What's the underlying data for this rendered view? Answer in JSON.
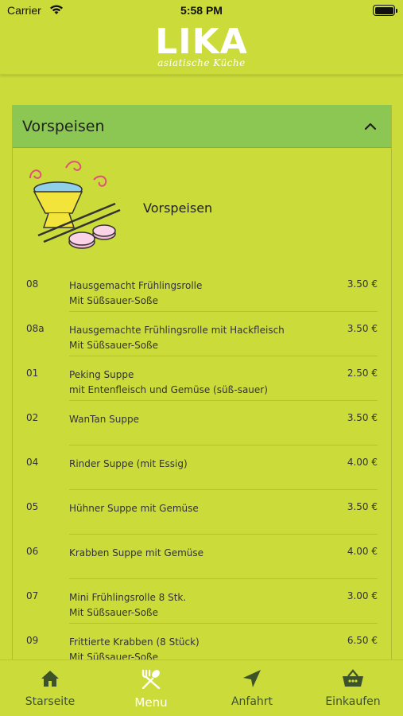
{
  "status": {
    "carrier": "Carrier",
    "time": "5:58 PM"
  },
  "header": {
    "logo": "LIKA",
    "tagline": "asiatische Küche"
  },
  "section": {
    "title": "Vorspeisen",
    "intro_title": "Vorspeisen"
  },
  "items": [
    {
      "num": "08",
      "line1": "Hausgemacht Frühlingsrolle",
      "line2": "Mit Süßsauer-Soße",
      "price": "3.50 €"
    },
    {
      "num": "08a",
      "line1": "Hausgemachte Frühlingsrolle mit Hackfleisch",
      "line2": "Mit Süßsauer-Soße",
      "price": "3.50 €"
    },
    {
      "num": "01",
      "line1": "Peking Suppe",
      "line2": "mit Entenfleisch und Gemüse (süß-sauer)",
      "price": "2.50 €"
    },
    {
      "num": "02",
      "line1": "WanTan Suppe",
      "line2": "",
      "price": "3.50 €"
    },
    {
      "num": "04",
      "line1": "Rinder Suppe (mit Essig)",
      "line2": "",
      "price": "4.00 €"
    },
    {
      "num": "05",
      "line1": "Hühner Suppe mit Gemüse",
      "line2": "",
      "price": "3.50 €"
    },
    {
      "num": "06",
      "line1": "Krabben Suppe mit Gemüse",
      "line2": "",
      "price": "4.00 €"
    },
    {
      "num": "07",
      "line1": "Mini Frühlingsrolle 8 Stk.",
      "line2": "Mit Süßsauer-Soße",
      "price": "3.00 €"
    },
    {
      "num": "09",
      "line1": "Frittierte Krabben (8 Stück)",
      "line2": "Mit Süßsauer-Soße",
      "price": "6.50 €"
    }
  ],
  "tabs": [
    {
      "label": "Starseite",
      "icon": "home-icon"
    },
    {
      "label": "Menu",
      "icon": "fork-spoon-icon"
    },
    {
      "label": "Anfahrt",
      "icon": "navigation-arrow-icon"
    },
    {
      "label": "Einkaufen",
      "icon": "basket-icon"
    }
  ],
  "colors": {
    "background": "#cbdc3a",
    "section_header": "#8cc653",
    "active_tab": "#ffffff",
    "tab_text": "#3d5228"
  }
}
